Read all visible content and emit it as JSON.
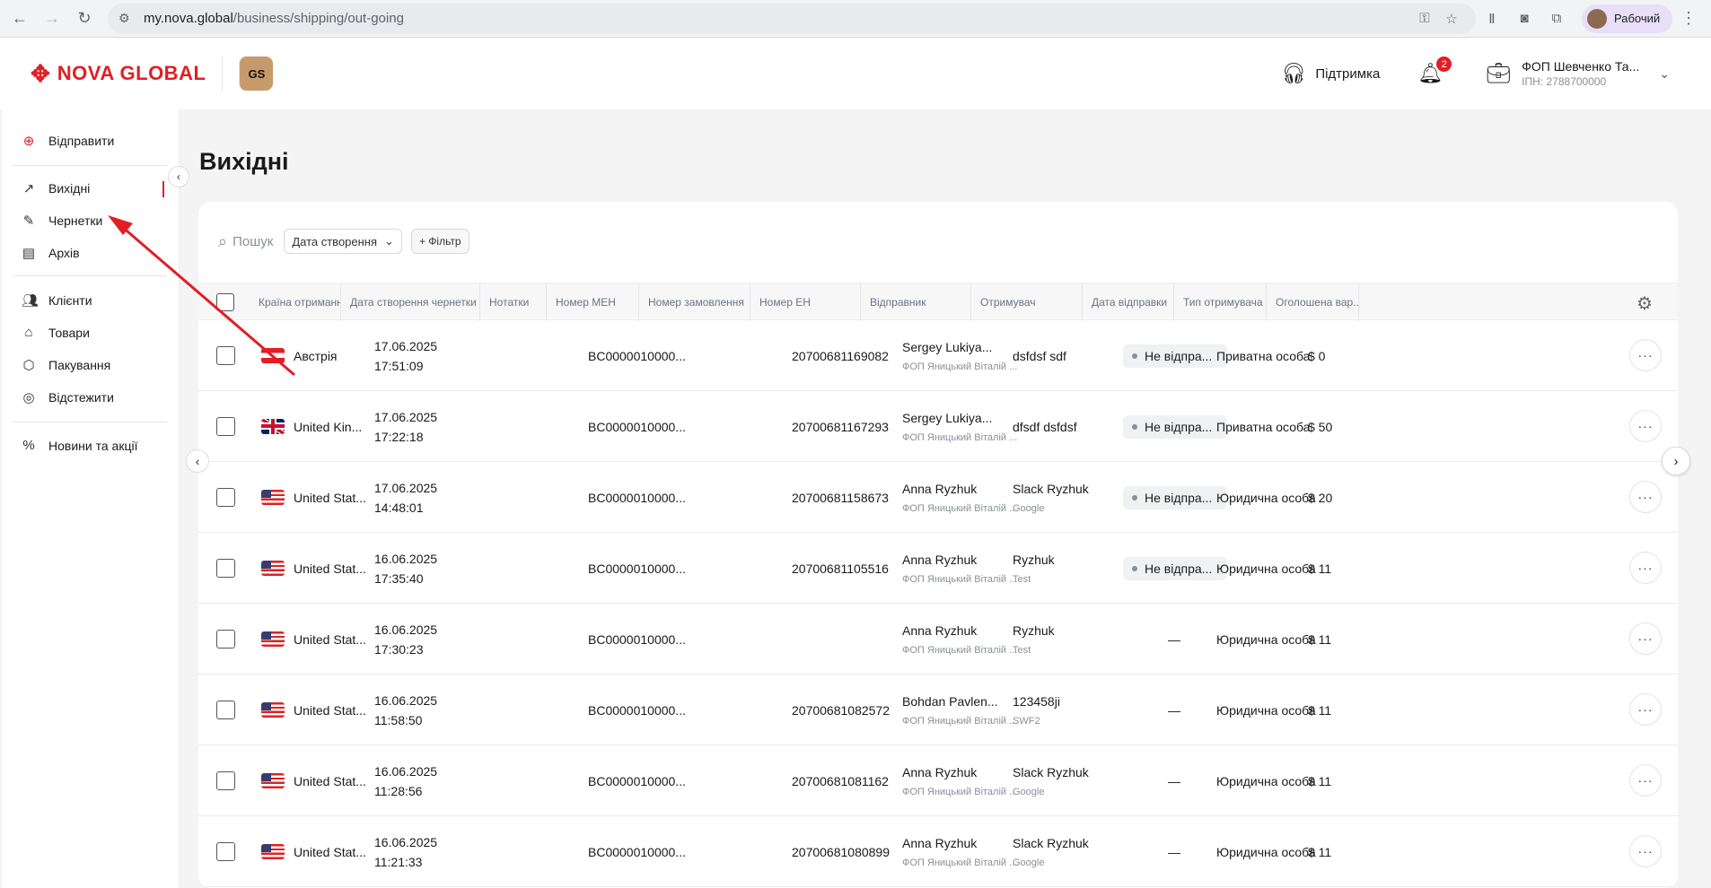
{
  "browser": {
    "url_host": "my.nova.global",
    "url_path": "/business/shipping/out-going",
    "profile_label": "Рабочий"
  },
  "header": {
    "logo_text": "NOVA GLOBAL",
    "badge_text": "GS",
    "support_label": "Підтримка",
    "notifications_count": "2",
    "account_name": "ФОП Шевченко Та...",
    "account_sub": "ІПН: 2788700000"
  },
  "sidebar": {
    "send_label": "Відправити",
    "items": [
      {
        "label": "Вихідні",
        "icon": "arrow-up-right-icon"
      },
      {
        "label": "Чернетки",
        "icon": "edit-icon"
      },
      {
        "label": "Архів",
        "icon": "archive-icon"
      },
      {
        "label": "Клієнти",
        "icon": "users-icon"
      },
      {
        "label": "Товари",
        "icon": "tag-icon"
      },
      {
        "label": "Пакування",
        "icon": "package-icon"
      },
      {
        "label": "Відстежити",
        "icon": "target-icon"
      },
      {
        "label": "Новини та акції",
        "icon": "percent-icon"
      }
    ]
  },
  "main": {
    "title": "Вихідні",
    "search_placeholder": "Пошук",
    "date_filter": "Дата створення",
    "add_filter": "+ Фільтр"
  },
  "table": {
    "columns": [
      "Країна отримання",
      "Дата створення чернетки",
      "Нотатки",
      "Номер МЕН",
      "Номер замовлення",
      "Номер ЕН",
      "Відправник",
      "Отримувач",
      "Дата відправки",
      "Тип отримувача",
      "Оголошена вар..."
    ],
    "rows": [
      {
        "flag": "at",
        "country": "Австрія",
        "date": "17.06.2025",
        "time": "17:51:09",
        "men": "BC0000010000...",
        "en": "20700681169082",
        "sender": "Sergey Lukiya...",
        "sender_sub": "ФОП Яницький Віталій ...",
        "recipient": "dsfdsf sdf",
        "recipient_sub": "",
        "status": "Не відпра...",
        "rtype": "Приватна особа",
        "value": "$ 0"
      },
      {
        "flag": "gb",
        "country": "United Kin...",
        "date": "17.06.2025",
        "time": "17:22:18",
        "men": "BC0000010000...",
        "en": "20700681167293",
        "sender": "Sergey Lukiya...",
        "sender_sub": "ФОП Яницький Віталій ...",
        "recipient": "dfsdf dsfdsf",
        "recipient_sub": "",
        "status": "Не відпра...",
        "rtype": "Приватна особа",
        "value": "$ 50"
      },
      {
        "flag": "us",
        "country": "United Stat...",
        "date": "17.06.2025",
        "time": "14:48:01",
        "men": "BC0000010000...",
        "en": "20700681158673",
        "sender": "Anna Ryzhuk",
        "sender_sub": "ФОП Яницький Віталій ...",
        "recipient": "Slack Ryzhuk",
        "recipient_sub": "Google",
        "status": "Не відпра...",
        "rtype": "Юридична особа",
        "value": "$ 20"
      },
      {
        "flag": "us",
        "country": "United Stat...",
        "date": "16.06.2025",
        "time": "17:35:40",
        "men": "BC0000010000...",
        "en": "20700681105516",
        "sender": "Anna Ryzhuk",
        "sender_sub": "ФОП Яницький Віталій ...",
        "recipient": "Ryzhuk",
        "recipient_sub": "Test",
        "status": "Не відпра...",
        "rtype": "Юридична особа",
        "value": "$ 11"
      },
      {
        "flag": "us",
        "country": "United Stat...",
        "date": "16.06.2025",
        "time": "17:30:23",
        "men": "BC0000010000...",
        "en": "",
        "sender": "Anna Ryzhuk",
        "sender_sub": "ФОП Яницький Віталій ...",
        "recipient": "Ryzhuk",
        "recipient_sub": "Test",
        "status": "",
        "dash": "—",
        "rtype": "Юридична особа",
        "value": "$ 11"
      },
      {
        "flag": "us",
        "country": "United Stat...",
        "date": "16.06.2025",
        "time": "11:58:50",
        "men": "BC0000010000...",
        "en": "20700681082572",
        "sender": "Bohdan Pavlen...",
        "sender_sub": "ФОП Яницький Віталій ...",
        "recipient": "123458ji",
        "recipient_sub": "SWF2",
        "status": "",
        "dash": "—",
        "rtype": "Юридична особа",
        "value": "$ 11"
      },
      {
        "flag": "us",
        "country": "United Stat...",
        "date": "16.06.2025",
        "time": "11:28:56",
        "men": "BC0000010000...",
        "en": "20700681081162",
        "sender": "Anna Ryzhuk",
        "sender_sub": "ФОП Яницький Віталій ...",
        "recipient": "Slack Ryzhuk",
        "recipient_sub": "Google",
        "status": "",
        "dash": "—",
        "rtype": "Юридична особа",
        "value": "$ 11"
      },
      {
        "flag": "us",
        "country": "United Stat...",
        "date": "16.06.2025",
        "time": "11:21:33",
        "men": "BC0000010000...",
        "en": "20700681080899",
        "sender": "Anna Ryzhuk",
        "sender_sub": "ФОП Яницький Віталій ...",
        "recipient": "Slack Ryzhuk",
        "recipient_sub": "Google",
        "status": "",
        "dash": "—",
        "rtype": "Юридична особа",
        "value": "$ 11"
      }
    ]
  },
  "colors": {
    "brand_red": "#e31e24",
    "annotation_arrow": "#e31e24"
  }
}
